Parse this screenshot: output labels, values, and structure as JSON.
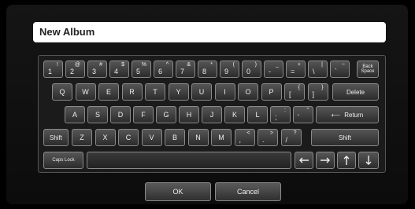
{
  "field": {
    "value": "New Album"
  },
  "keyboard": {
    "back_space": "Back Space",
    "delete": "Delete",
    "return": "Return",
    "shift_left": "Shift",
    "shift_right": "Shift",
    "caps_lock": "Caps Lock",
    "row1": [
      {
        "lo": "1",
        "hi": "!"
      },
      {
        "lo": "2",
        "hi": "@"
      },
      {
        "lo": "3",
        "hi": "#"
      },
      {
        "lo": "4",
        "hi": "$"
      },
      {
        "lo": "5",
        "hi": "%"
      },
      {
        "lo": "6",
        "hi": "^"
      },
      {
        "lo": "7",
        "hi": "&"
      },
      {
        "lo": "8",
        "hi": "*"
      },
      {
        "lo": "9",
        "hi": "("
      },
      {
        "lo": "0",
        "hi": ")"
      },
      {
        "lo": "-",
        "hi": "_"
      },
      {
        "lo": "=",
        "hi": "+"
      },
      {
        "lo": "\\",
        "hi": "|"
      },
      {
        "lo": "`",
        "hi": "~"
      }
    ],
    "row2": [
      "Q",
      "W",
      "E",
      "R",
      "T",
      "Y",
      "U",
      "I",
      "O",
      "P",
      {
        "lo": "[",
        "hi": "{"
      },
      {
        "lo": "]",
        "hi": "}"
      }
    ],
    "row3": [
      "A",
      "S",
      "D",
      "F",
      "G",
      "H",
      "J",
      "K",
      "L",
      {
        "lo": ";",
        "hi": ":"
      },
      {
        "lo": "'",
        "hi": "\""
      }
    ],
    "row4": [
      "Z",
      "X",
      "C",
      "V",
      "B",
      "N",
      "M",
      {
        "lo": ",",
        "hi": "<"
      },
      {
        "lo": ".",
        "hi": ">"
      },
      {
        "lo": "/",
        "hi": "?"
      }
    ],
    "arrows": [
      "left-arrow-icon",
      "right-arrow-icon",
      "up-arrow-icon",
      "down-arrow-icon"
    ]
  },
  "buttons": {
    "ok": "OK",
    "cancel": "Cancel"
  }
}
